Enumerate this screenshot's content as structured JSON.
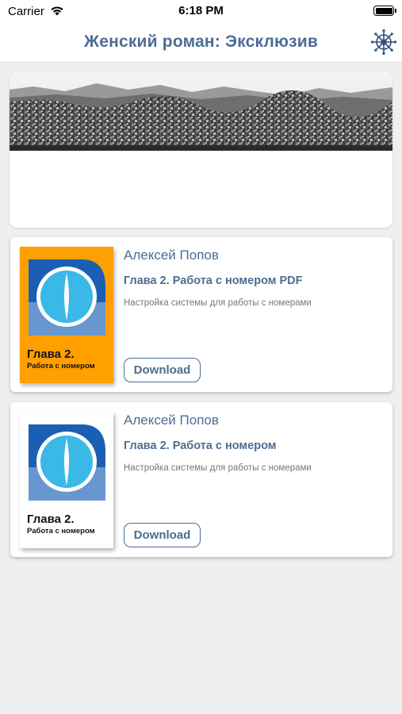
{
  "status_bar": {
    "carrier": "Carrier",
    "time": "6:18 PM"
  },
  "nav": {
    "title": "Женский роман: Эксклюзив",
    "icon": "ships-wheel-icon"
  },
  "banner": {
    "image": "mountain-landscape-image"
  },
  "books": [
    {
      "author": "Алексей Попов",
      "title": "Глава 2. Работа с номером PDF",
      "description": "Настройка системы для работы с номерами",
      "cover_title": "Глава 2.",
      "cover_subtitle": "Работа с номером",
      "cover_bg": "#ff9f00",
      "download_label": "Download"
    },
    {
      "author": "Алексей Попов",
      "title": "Глава 2. Работа с номером",
      "description": "Настройка системы для работы с номерами",
      "cover_title": "Глава 2.",
      "cover_subtitle": "Работа с номером",
      "cover_bg": "#ffffff",
      "download_label": "Download"
    }
  ],
  "colors": {
    "accent": "#4c6d91",
    "background": "#efeff2",
    "cover_eye": "#3ab8e8",
    "cover_frame": "#1a5fb4"
  }
}
